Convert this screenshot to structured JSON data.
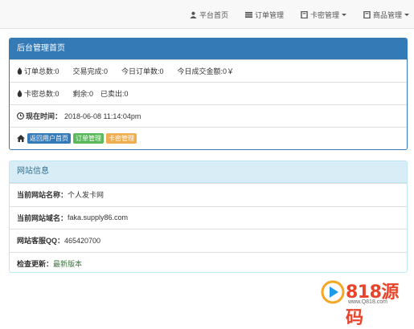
{
  "nav": {
    "items": [
      {
        "label": "平台首页",
        "icon": "user-icon",
        "dropdown": false
      },
      {
        "label": "订单管理",
        "icon": "list-icon",
        "dropdown": false
      },
      {
        "label": "卡密管理",
        "icon": "book-icon",
        "dropdown": true
      },
      {
        "label": "商品管理",
        "icon": "book-icon",
        "dropdown": true
      }
    ]
  },
  "admin_panel": {
    "title": "后台管理首页",
    "stats1": [
      "订单总数:0",
      "交易完成:0",
      "今日订单数:0",
      "今日成交金额:0￥"
    ],
    "stats2": [
      "卡密总数:0",
      "剩余:0",
      "已卖出:0"
    ],
    "time_label": "现在时间：",
    "time_value": "2018-06-08 11:14:04pm",
    "buttons": [
      "返回用户首页",
      "订单管理",
      "卡密管理"
    ]
  },
  "site_panel": {
    "title": "网站信息",
    "name_label": "当前网站名称：",
    "name_value": "个人发卡网",
    "domain_label": "当前网站域名：",
    "domain_value": "faka.supply86.com",
    "qq_label": "网站客服QQ：",
    "qq_value": "465420700",
    "update_label": "检查更新：",
    "update_value": "最新版本"
  },
  "watermark": {
    "text": "818源码",
    "url": "www.Q818.com"
  },
  "colors": {
    "primary": "#337ab7",
    "info_bg": "#d9edf7",
    "success": "#5cb85c",
    "warning": "#f0ad4e",
    "latest": "#3c763d"
  }
}
